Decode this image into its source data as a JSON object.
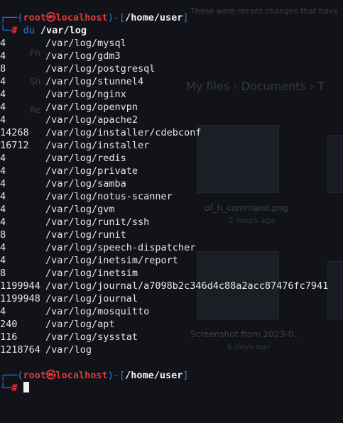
{
  "background_hint": {
    "banner": "These were recent changes that have",
    "breadcrumb": "My files  ›  Documents  ›  T",
    "sidebar": [
      "Ph",
      "Sh",
      "Re"
    ],
    "captions": [
      {
        "title": "of_h_command.png",
        "sub": "2 hours ago"
      },
      {
        "title": "Screenshot from 2023-0..",
        "sub": "6 days ago"
      }
    ]
  },
  "prompt1": {
    "open": "┌──(",
    "user": "root",
    "at": "㉿",
    "host": "localhost",
    "mid": ")-[",
    "path": "/home/user",
    "close": "]",
    "corner": "└─",
    "hash": "# ",
    "cmd": "du",
    "arg": " /var/log"
  },
  "rows": [
    {
      "size": "4",
      "path": "/var/log/mysql"
    },
    {
      "size": "4",
      "path": "/var/log/gdm3"
    },
    {
      "size": "8",
      "path": "/var/log/postgresql"
    },
    {
      "size": "4",
      "path": "/var/log/stunnel4"
    },
    {
      "size": "4",
      "path": "/var/log/nginx"
    },
    {
      "size": "4",
      "path": "/var/log/openvpn"
    },
    {
      "size": "4",
      "path": "/var/log/apache2"
    },
    {
      "size": "14268",
      "path": "/var/log/installer/cdebconf"
    },
    {
      "size": "16712",
      "path": "/var/log/installer"
    },
    {
      "size": "4",
      "path": "/var/log/redis"
    },
    {
      "size": "4",
      "path": "/var/log/private"
    },
    {
      "size": "4",
      "path": "/var/log/samba"
    },
    {
      "size": "4",
      "path": "/var/log/notus-scanner"
    },
    {
      "size": "4",
      "path": "/var/log/gvm"
    },
    {
      "size": "4",
      "path": "/var/log/runit/ssh"
    },
    {
      "size": "8",
      "path": "/var/log/runit"
    },
    {
      "size": "4",
      "path": "/var/log/speech-dispatcher"
    },
    {
      "size": "4",
      "path": "/var/log/inetsim/report"
    },
    {
      "size": "8",
      "path": "/var/log/inetsim"
    },
    {
      "size": "1199944",
      "path": "/var/log/journal/a7098b2c346d4c88a2acc87476fc7941"
    },
    {
      "size": "1199948",
      "path": "/var/log/journal"
    },
    {
      "size": "4",
      "path": "/var/log/mosquitto"
    },
    {
      "size": "240",
      "path": "/var/log/apt"
    },
    {
      "size": "116",
      "path": "/var/log/sysstat"
    },
    {
      "size": "1218764",
      "path": "/var/log"
    }
  ],
  "prompt2": {
    "open": "┌──(",
    "user": "root",
    "at": "㉿",
    "host": "localhost",
    "mid": ")-[",
    "path": "/home/user",
    "close": "]",
    "corner": "└─",
    "hash": "# "
  }
}
